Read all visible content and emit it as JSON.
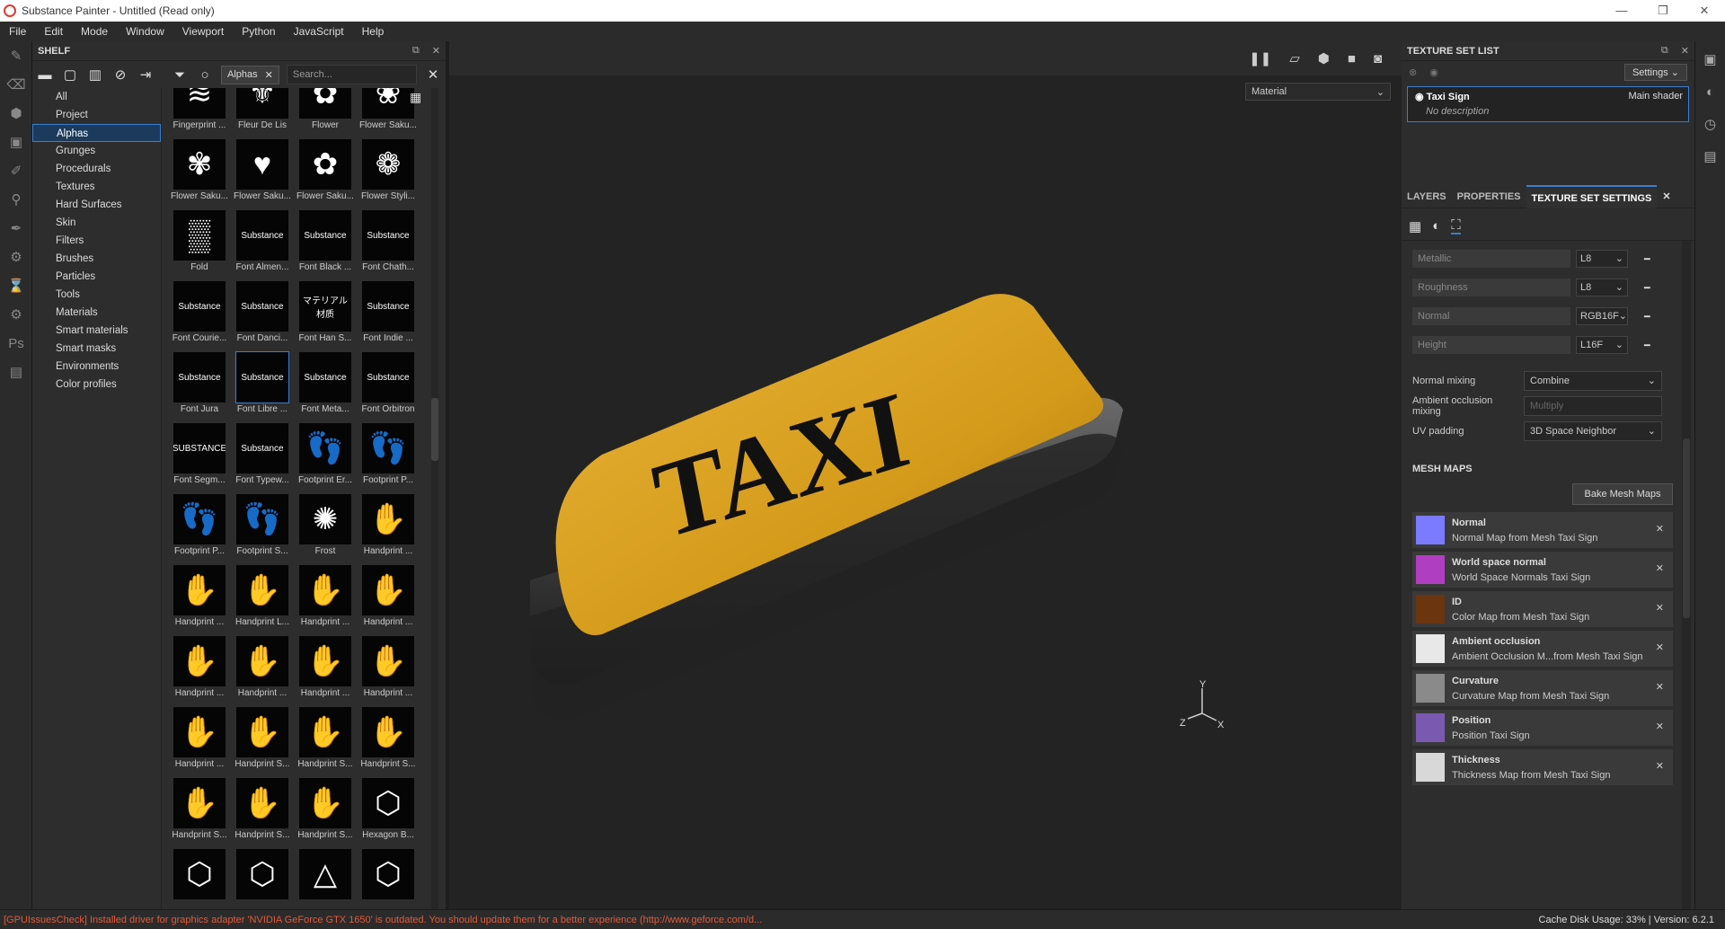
{
  "window": {
    "title": "Substance Painter - Untitled (Read only)",
    "minimize": "—",
    "maximize": "❐",
    "close": "✕"
  },
  "menu": [
    "File",
    "Edit",
    "Mode",
    "Window",
    "Viewport",
    "Python",
    "JavaScript",
    "Help"
  ],
  "shelf": {
    "title": "SHELF",
    "filter_chip": "Alphas",
    "search_placeholder": "Search...",
    "categories": [
      "All",
      "Project",
      "Alphas",
      "Grunges",
      "Procedurals",
      "Textures",
      "Hard Surfaces",
      "Skin",
      "Filters",
      "Brushes",
      "Particles",
      "Tools",
      "Materials",
      "Smart materials",
      "Smart masks",
      "Environments",
      "Color profiles"
    ],
    "selected_category": "Alphas",
    "items": [
      {
        "label": "Fingerprint ...",
        "thumb": "≋"
      },
      {
        "label": "Fleur De Lis",
        "thumb": "⚜"
      },
      {
        "label": "Flower",
        "thumb": "✿"
      },
      {
        "label": "Flower Saku...",
        "thumb": "❀"
      },
      {
        "label": "Flower Saku...",
        "thumb": "✾"
      },
      {
        "label": "Flower Saku...",
        "thumb": "♥"
      },
      {
        "label": "Flower Saku...",
        "thumb": "✿"
      },
      {
        "label": "Flower Styli...",
        "thumb": "❁"
      },
      {
        "label": "Fold",
        "thumb": "▒"
      },
      {
        "label": "Font Almen...",
        "thumb": "Substance"
      },
      {
        "label": "Font Black ...",
        "thumb": "Substance"
      },
      {
        "label": "Font Chath...",
        "thumb": "Substance"
      },
      {
        "label": "Font Courie...",
        "thumb": "Substance"
      },
      {
        "label": "Font Danci...",
        "thumb": "Substance"
      },
      {
        "label": "Font Han S...",
        "thumb": "マテリアル材质"
      },
      {
        "label": "Font Indie ...",
        "thumb": "Substance"
      },
      {
        "label": "Font Jura",
        "thumb": "Substance"
      },
      {
        "label": "Font Libre ...",
        "thumb": "Substance"
      },
      {
        "label": "Font Meta...",
        "thumb": "Substance"
      },
      {
        "label": "Font Orbitron",
        "thumb": "Substance"
      },
      {
        "label": "Font Segm...",
        "thumb": "SUBSTANCE"
      },
      {
        "label": "Font Typew...",
        "thumb": "Substance"
      },
      {
        "label": "Footprint Er...",
        "thumb": "👣"
      },
      {
        "label": "Footprint P...",
        "thumb": "👣"
      },
      {
        "label": "Footprint P...",
        "thumb": "👣"
      },
      {
        "label": "Footprint S...",
        "thumb": "👣"
      },
      {
        "label": "Frost",
        "thumb": "✺"
      },
      {
        "label": "Handprint ...",
        "thumb": "✋"
      },
      {
        "label": "Handprint ...",
        "thumb": "✋"
      },
      {
        "label": "Handprint L...",
        "thumb": "✋"
      },
      {
        "label": "Handprint ...",
        "thumb": "✋"
      },
      {
        "label": "Handprint ...",
        "thumb": "✋"
      },
      {
        "label": "Handprint ...",
        "thumb": "✋"
      },
      {
        "label": "Handprint ...",
        "thumb": "✋"
      },
      {
        "label": "Handprint ...",
        "thumb": "✋"
      },
      {
        "label": "Handprint ...",
        "thumb": "✋"
      },
      {
        "label": "Handprint ...",
        "thumb": "✋"
      },
      {
        "label": "Handprint S...",
        "thumb": "✋"
      },
      {
        "label": "Handprint S...",
        "thumb": "✋"
      },
      {
        "label": "Handprint S...",
        "thumb": "✋"
      },
      {
        "label": "Handprint S...",
        "thumb": "✋"
      },
      {
        "label": "Handprint S...",
        "thumb": "✋"
      },
      {
        "label": "Handprint S...",
        "thumb": "✋"
      },
      {
        "label": "Hexagon B...",
        "thumb": "⬡"
      },
      {
        "label": "",
        "thumb": "⬡"
      },
      {
        "label": "",
        "thumb": "⬡"
      },
      {
        "label": "",
        "thumb": "△"
      },
      {
        "label": "",
        "thumb": "⬡"
      }
    ],
    "selected_item": "Font Libre ..."
  },
  "viewport": {
    "material_select": "Material",
    "model_text": "TAXI",
    "axis": {
      "x": "X",
      "y": "Y",
      "z": "Z"
    }
  },
  "texture_set_list": {
    "title": "TEXTURE SET LIST",
    "settings_label": "Settings",
    "set_name": "Taxi Sign",
    "shader": "Main shader",
    "description": "No description"
  },
  "tabs": [
    "LAYERS",
    "PROPERTIES",
    "TEXTURE SET SETTINGS"
  ],
  "active_tab": "TEXTURE SET SETTINGS",
  "channels": [
    {
      "name": "Metallic",
      "format": "L8"
    },
    {
      "name": "Roughness",
      "format": "L8"
    },
    {
      "name": "Normal",
      "format": "RGB16F"
    },
    {
      "name": "Height",
      "format": "L16F"
    }
  ],
  "properties": [
    {
      "label": "Normal mixing",
      "value": "Combine",
      "disabled": false
    },
    {
      "label": "Ambient occlusion mixing",
      "value": "Multiply",
      "disabled": true
    },
    {
      "label": "UV padding",
      "value": "3D Space Neighbor",
      "disabled": false
    }
  ],
  "mesh_maps": {
    "title": "MESH MAPS",
    "bake_label": "Bake Mesh Maps",
    "maps": [
      {
        "title": "Normal",
        "desc": "Normal Map from Mesh Taxi Sign",
        "color": "#7b7bff"
      },
      {
        "title": "World space normal",
        "desc": "World Space Normals Taxi Sign",
        "color": "#b03ec0"
      },
      {
        "title": "ID",
        "desc": "Color Map from Mesh Taxi Sign",
        "color": "#6b3510"
      },
      {
        "title": "Ambient occlusion",
        "desc": "Ambient Occlusion M...from Mesh Taxi Sign",
        "color": "#e8e8e8"
      },
      {
        "title": "Curvature",
        "desc": "Curvature Map from Mesh Taxi Sign",
        "color": "#8a8a8a"
      },
      {
        "title": "Position",
        "desc": "Position Taxi Sign",
        "color": "#7a5ab0"
      },
      {
        "title": "Thickness",
        "desc": "Thickness Map from Mesh Taxi Sign",
        "color": "#d8d8d8"
      }
    ]
  },
  "status": {
    "error": "[GPUIssuesCheck] Installed driver for graphics adapter 'NVIDIA GeForce GTX 1650' is outdated. You should update them for a better experience (http://www.geforce.com/d...",
    "info": "Cache Disk Usage:    33% | Version: 6.2.1"
  }
}
